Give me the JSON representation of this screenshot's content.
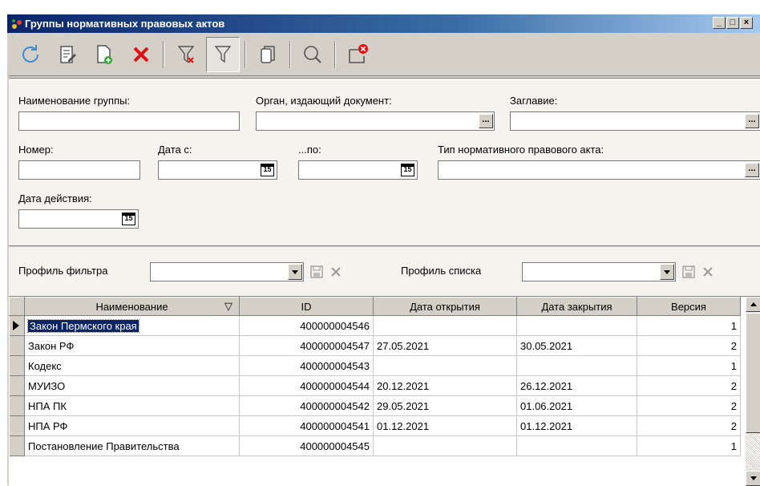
{
  "window": {
    "title": "Группы нормативных правовых актов",
    "controls": [
      "_",
      "□",
      "×"
    ]
  },
  "toolbar": {
    "buttons": [
      {
        "icon": "refresh-icon"
      },
      {
        "icon": "edit-icon"
      },
      {
        "icon": "add-document-icon"
      },
      {
        "icon": "delete-icon"
      },
      {
        "icon": "clear-filter-icon"
      },
      {
        "icon": "filter-icon",
        "pressed": true
      },
      {
        "icon": "copy-icon"
      },
      {
        "icon": "search-icon"
      },
      {
        "icon": "close-window-icon"
      }
    ]
  },
  "filters": {
    "group_name_label": "Наименование группы:",
    "group_name_value": "",
    "issuer_label": "Орган, издающий документ:",
    "issuer_value": "",
    "title_label": "Заглавие:",
    "title_value": "",
    "number_label": "Номер:",
    "number_value": "",
    "date_from_label": "Дата с:",
    "date_from_value": "",
    "date_to_label": "...по:",
    "date_to_value": "",
    "act_type_label": "Тип нормативного правового акта:",
    "act_type_value": "",
    "valid_date_label": "Дата действия:",
    "valid_date_value": "",
    "ellipsis": "...",
    "calendar": "15"
  },
  "profiles": {
    "filter_profile_label": "Профиль фильтра",
    "filter_profile_value": "",
    "list_profile_label": "Профиль списка",
    "list_profile_value": ""
  },
  "table": {
    "columns": [
      "Наименование",
      "ID",
      "Дата открытия",
      "Дата закрытия",
      "Версия"
    ],
    "sort_indicator": "▽",
    "rows": [
      {
        "name": "Закон Пермского края",
        "id": "400000004546",
        "open": "",
        "close": "",
        "version": "1",
        "selected": true
      },
      {
        "name": "Закон РФ",
        "id": "400000004547",
        "open": "27.05.2021",
        "close": "30.05.2021",
        "version": "2"
      },
      {
        "name": "Кодекс",
        "id": "400000004543",
        "open": "",
        "close": "",
        "version": "1"
      },
      {
        "name": "МУИЗО",
        "id": "400000004544",
        "open": "20.12.2021",
        "close": "26.12.2021",
        "version": "2"
      },
      {
        "name": "НПА ПК",
        "id": "400000004542",
        "open": "29.05.2021",
        "close": "01.06.2021",
        "version": "2"
      },
      {
        "name": "НПА РФ",
        "id": "400000004541",
        "open": "01.12.2021",
        "close": "01.12.2021",
        "version": "2"
      },
      {
        "name": "Постановление Правительства",
        "id": "400000004545",
        "open": "",
        "close": "",
        "version": "1"
      }
    ]
  },
  "colors": {
    "title_bar": "#0a246a",
    "selection": "#0a246a",
    "delete_red": "#e01010",
    "toolbar_icon": "#3c8ad8"
  }
}
